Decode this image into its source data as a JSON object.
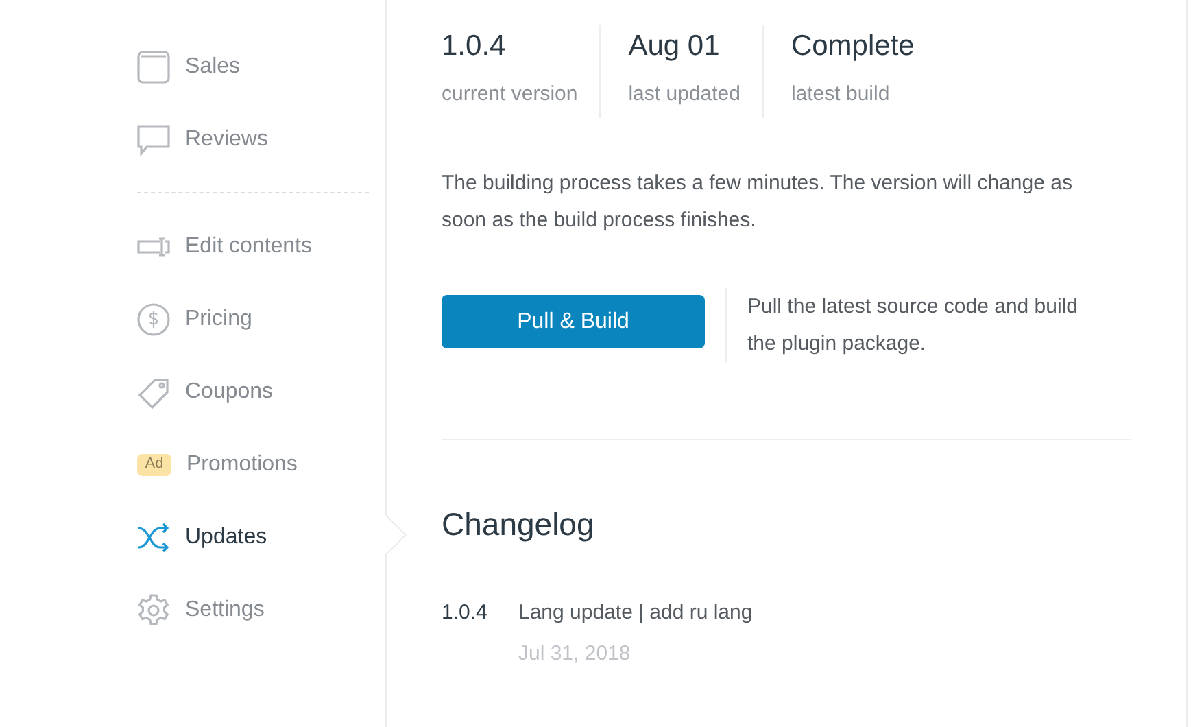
{
  "sidebar": {
    "groups": [
      [
        {
          "kind": "sales",
          "label": "Sales",
          "selected": false
        },
        {
          "kind": "reviews",
          "label": "Reviews",
          "selected": false
        }
      ],
      [
        {
          "kind": "edit",
          "label": "Edit contents",
          "selected": false
        },
        {
          "kind": "pricing",
          "label": "Pricing",
          "selected": false
        },
        {
          "kind": "coupons",
          "label": "Coupons",
          "selected": false
        },
        {
          "kind": "promotions",
          "label": "Promotions",
          "badge": "Ad",
          "selected": false
        },
        {
          "kind": "updates",
          "label": "Updates",
          "selected": true
        },
        {
          "kind": "settings",
          "label": "Settings",
          "selected": false
        }
      ]
    ]
  },
  "stats": [
    {
      "value": "1.0.4",
      "label": "current version"
    },
    {
      "value": "Aug 01",
      "label": "last updated"
    },
    {
      "value": "Complete",
      "label": "latest build"
    }
  ],
  "build_note": "The building process takes a few minutes. The version will change as soon as the build process finishes.",
  "build_button": "Pull & Build",
  "build_hint": "Pull the latest source code and build the plugin package.",
  "changelog": {
    "title": "Changelog",
    "entries": [
      {
        "version": "1.0.4",
        "text": "Lang update | add ru lang",
        "date": "Jul 31, 2018"
      }
    ]
  }
}
